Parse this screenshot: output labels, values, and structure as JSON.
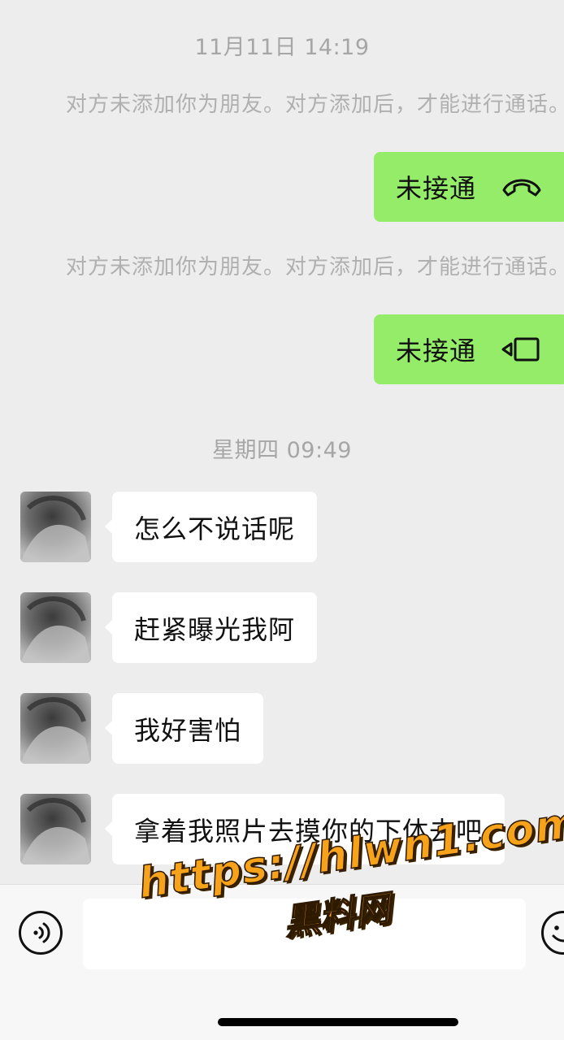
{
  "messages": {
    "timestamp_1": "11月11日 14:19",
    "system_notice_1": "对方未添加你为朋友。对方添加后，才能进行通话。",
    "call_1": {
      "label": "未接通",
      "icon": "voice-call-icon"
    },
    "system_notice_2": "对方未添加你为朋友。对方添加后，才能进行通话。",
    "call_2": {
      "label": "未接通",
      "icon": "video-call-icon"
    },
    "timestamp_2": "星期四 09:49",
    "incoming": [
      {
        "text": "怎么不说话呢"
      },
      {
        "text": "赶紧曝光我阿"
      },
      {
        "text": "我好害怕"
      },
      {
        "text": "拿着我照片去摸你的下体去吧"
      }
    ]
  },
  "input_bar": {
    "voice_icon": "voice-input-icon",
    "text_value": "",
    "emoji_icon": "emoji-icon"
  },
  "watermark": {
    "url": "https://hlwn1.com",
    "name": "黑料网"
  },
  "colors": {
    "background": "#ededed",
    "outgoing_bubble": "#95ec69",
    "incoming_bubble": "#ffffff",
    "watermark": "#f6a21a"
  }
}
